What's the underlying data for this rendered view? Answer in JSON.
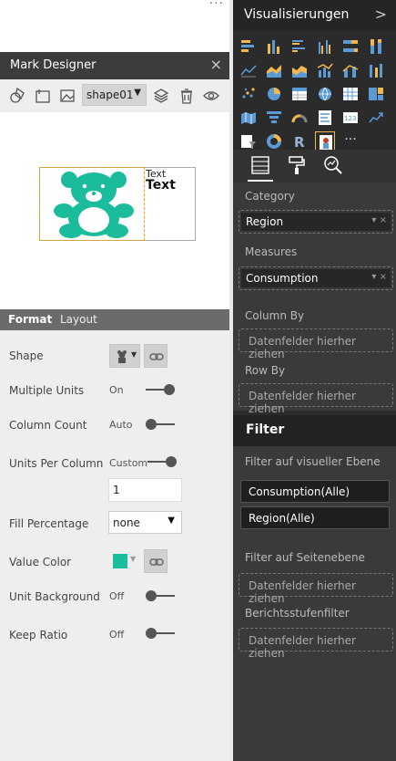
{
  "mark_designer": {
    "title": "Mark Designer",
    "close_glyph": "×",
    "shape_select": "shape01",
    "tabs": {
      "format": "Format",
      "layout": "Layout"
    },
    "preview": {
      "text_small": "Text",
      "text_large": "Text",
      "shape": "teddy-bear",
      "shape_color": "#1abc9c"
    },
    "props": {
      "shape": "Shape",
      "multiple_units": "Multiple Units",
      "multiple_units_val": "On",
      "column_count": "Column Count",
      "column_count_val": "Auto",
      "units_per_column": "Units Per Column",
      "units_per_column_val": "Custom",
      "units_input": "1",
      "fill_percentage": "Fill Percentage",
      "fill_select": "none",
      "value_color": "Value Color",
      "value_color_hex": "#1abc9c",
      "unit_background": "Unit Background",
      "unit_background_val": "Off",
      "keep_ratio": "Keep Ratio",
      "keep_ratio_val": "Off"
    }
  },
  "visualizations": {
    "title": "Visualisierungen",
    "more": "···",
    "wells": {
      "category": "Category",
      "category_field": "Region",
      "measures": "Measures",
      "measures_field": "Consumption",
      "column_by": "Column By",
      "row_by": "Row By",
      "placeholder": "Datenfelder hierher ziehen"
    },
    "filter": {
      "title": "Filter",
      "visual_level": "Filter auf visueller Ebene",
      "chip1": "Consumption(Alle)",
      "chip2": "Region(Alle)",
      "page_level": "Filter auf Seitenebene",
      "report_level": "Berichtsstufenfilter",
      "placeholder": "Datenfelder hierher ziehen"
    }
  }
}
